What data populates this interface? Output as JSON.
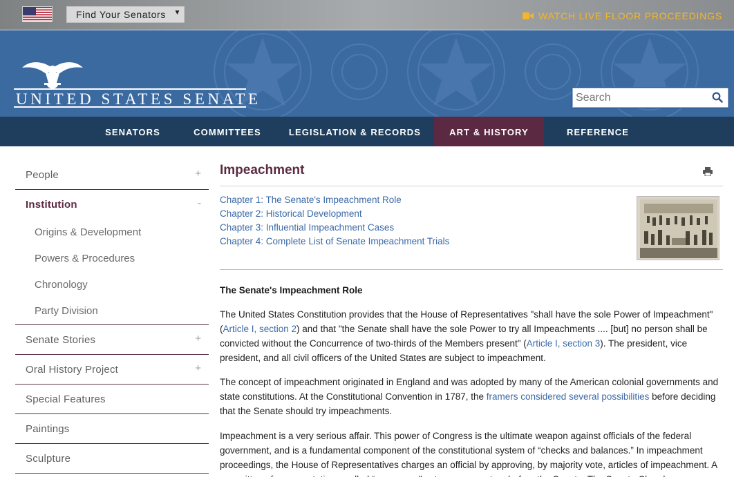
{
  "utility_bar": {
    "find_senators": "Find Your Senators",
    "live_proceedings": "WATCH LIVE FLOOR PROCEEDINGS"
  },
  "header": {
    "logo_text": "UNITED STATES SENATE",
    "search_placeholder": "Search"
  },
  "nav": {
    "items": [
      {
        "label": "SENATORS",
        "active": false
      },
      {
        "label": "COMMITTEES",
        "active": false
      },
      {
        "label": "LEGISLATION & RECORDS",
        "active": false
      },
      {
        "label": "ART & HISTORY",
        "active": true
      },
      {
        "label": "REFERENCE",
        "active": false
      }
    ]
  },
  "sidebar": {
    "people": {
      "label": "People",
      "toggle": "+"
    },
    "institution": {
      "label": "Institution",
      "toggle": "-",
      "children": [
        "Origins & Development",
        "Powers & Procedures",
        "Chronology",
        "Party Division"
      ]
    },
    "senate_stories": {
      "label": "Senate Stories",
      "toggle": "+"
    },
    "oral_history": {
      "label": "Oral History Project",
      "toggle": "+"
    },
    "special_features": {
      "label": "Special Features"
    },
    "paintings": {
      "label": "Paintings"
    },
    "sculpture": {
      "label": "Sculpture"
    }
  },
  "main": {
    "title": "Impeachment",
    "chapters": [
      "Chapter 1: The Senate's Impeachment Role",
      "Chapter 2: Historical Development",
      "Chapter 3: Influential Impeachment Cases",
      "Chapter 4: Complete List of Senate Impeachment Trials"
    ],
    "section_heading": "The Senate's Impeachment Role",
    "p1": {
      "a": "The United States Constitution provides that the House of Representatives \"shall have the sole Power of Impeachment\" (",
      "link1": "Article I, section 2",
      "b": ") and that \"the Senate shall have the sole Power to try all Impeachments .... [but] no person shall be convicted without the Concurrence of two-thirds of the Members present\" (",
      "link2": "Article I, section 3",
      "c": "). The president, vice president, and all civil officers of the United States are subject to impeachment."
    },
    "p2": {
      "a": "The concept of impeachment originated in England and was adopted by many of the American colonial governments and state constitutions. At the Constitutional Convention in 1787, the ",
      "link": "framers considered several possibilities",
      "b": " before deciding that the Senate should try impeachments."
    },
    "p3": "Impeachment is a very serious affair. This power of Congress is the ultimate weapon against officials of the federal government, and is a fundamental component of the constitutional system of “checks and balances.” In impeachment proceedings, the House of Representatives charges an official by approving, by majority vote, articles of impeachment. A committee of representatives, called “managers,” acts as prosecutors before the Senate. The Senate Chamber"
  },
  "colors": {
    "nav_bg": "#1f3d5d",
    "nav_active": "#5b2a42",
    "header_blue": "#3b6aa1",
    "link": "#3b6aa8",
    "accent_gold": "#f3b62b"
  }
}
